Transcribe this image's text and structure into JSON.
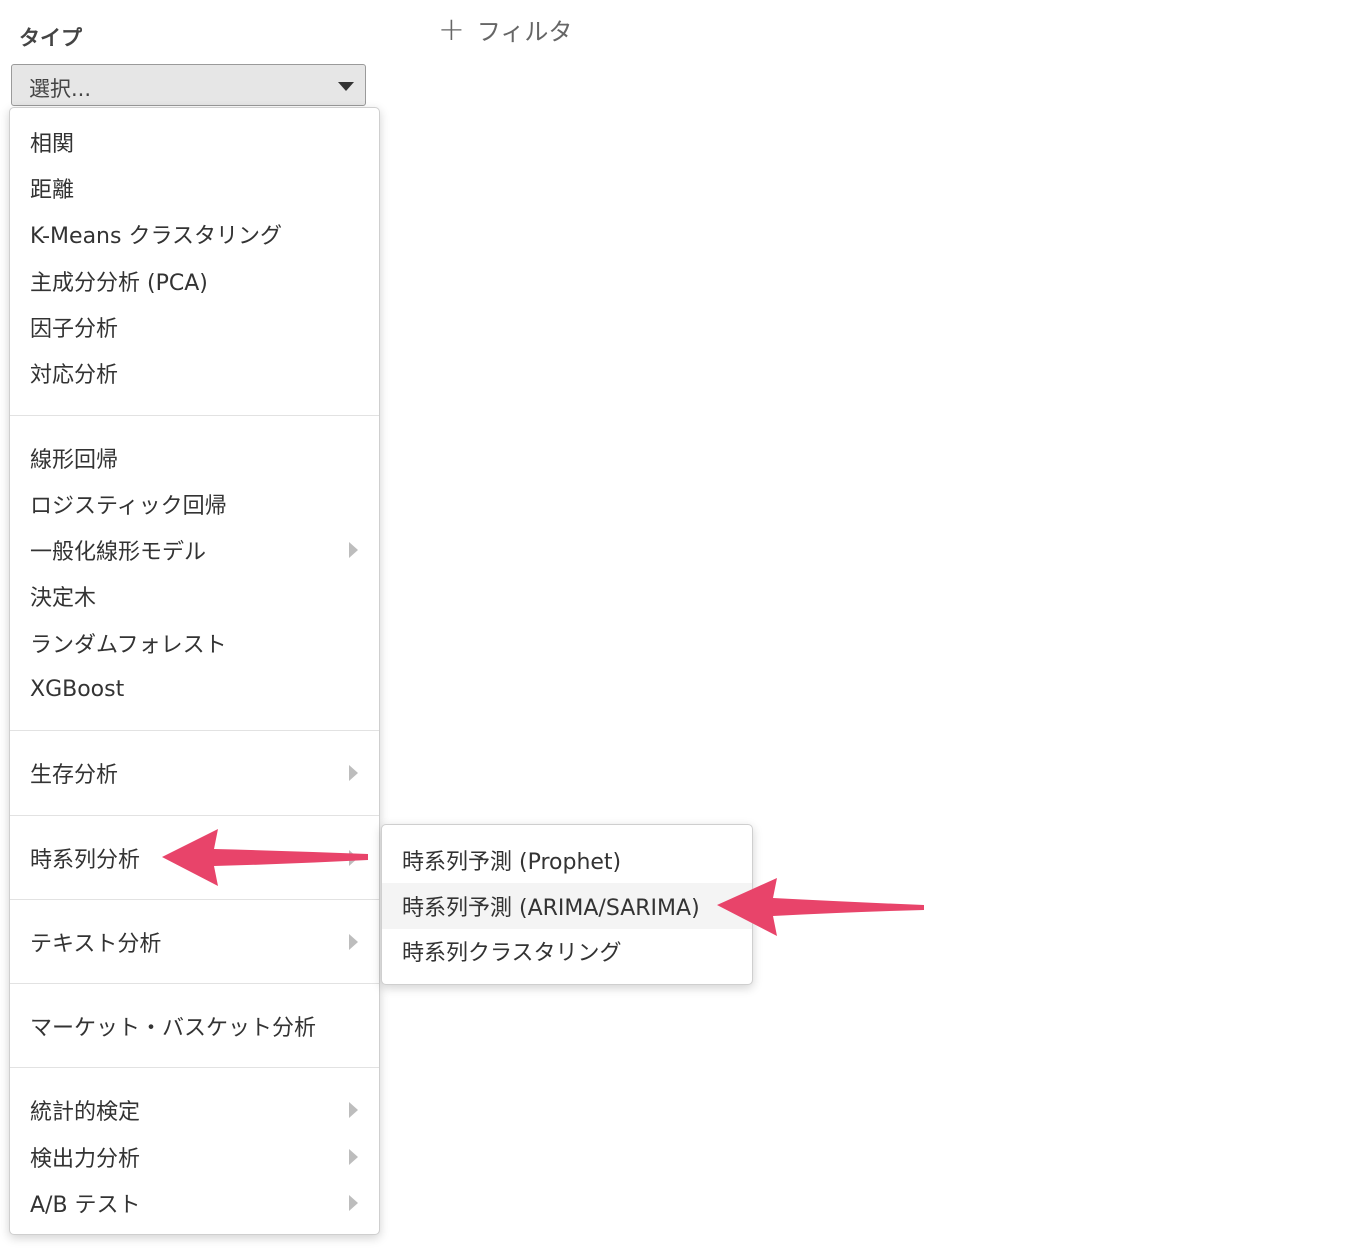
{
  "header": {
    "type_label": "タイプ",
    "add_filter_label": "フィルタ",
    "add_filter_icon": "+"
  },
  "select": {
    "value": "選択..."
  },
  "menu": {
    "group1": [
      "相関",
      "距離",
      "K-Means クラスタリング",
      "主成分分析 (PCA)",
      "因子分析",
      "対応分析"
    ],
    "group2": [
      "線形回帰",
      "ロジスティック回帰",
      "一般化線形モデル",
      "決定木",
      "ランダムフォレスト",
      "XGBoost"
    ],
    "survival": "生存分析",
    "timeseries": "時系列分析",
    "text_analysis": "テキスト分析",
    "market_basket": "マーケット・バスケット分析",
    "group_stats": [
      "統計的検定",
      "検出力分析",
      "A/B テスト"
    ]
  },
  "submenu": {
    "items": [
      "時系列予測 (Prophet)",
      "時系列予測 (ARIMA/SARIMA)",
      "時系列クラスタリング"
    ],
    "highlighted_index": 1
  },
  "annotation": {
    "arrow_color": "#e8446a"
  }
}
